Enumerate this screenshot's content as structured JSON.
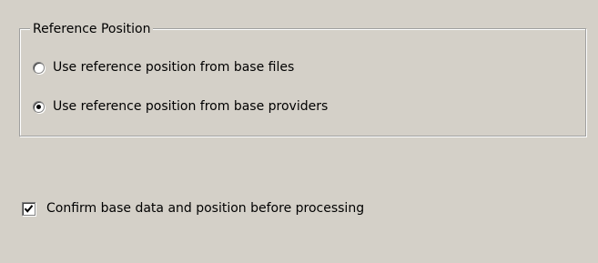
{
  "reference_position": {
    "group_title": "Reference Position",
    "options": [
      {
        "label": "Use reference position from base files",
        "selected": false
      },
      {
        "label": "Use reference position from base providers",
        "selected": true
      }
    ]
  },
  "confirm": {
    "label": "Confirm base data and position before processing",
    "checked": true
  }
}
